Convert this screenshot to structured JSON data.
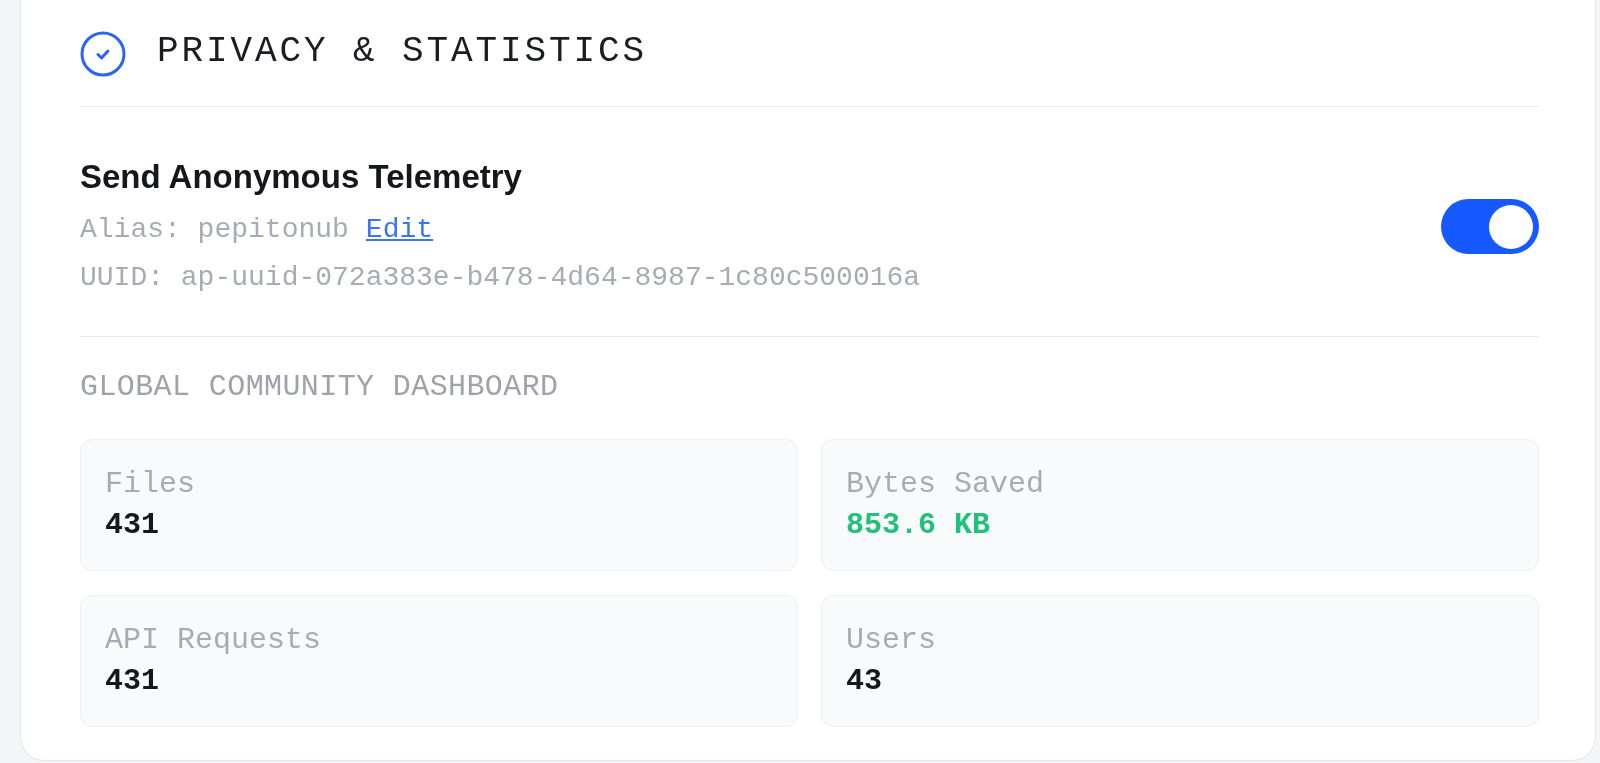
{
  "section": {
    "title": "PRIVACY & STATISTICS"
  },
  "telemetry": {
    "title": "Send Anonymous Telemetry",
    "alias": "Alias: pepitonub",
    "edit_link": "Edit",
    "uuid": "UUID: ap-uuid-072a383e-b478-4d64-8987-1c80c500016a",
    "on": true
  },
  "dashboard": {
    "title": "GLOBAL COMMUNITY DASHBOARD",
    "stats": [
      {
        "label": "Files",
        "value": "431",
        "kind": "count"
      },
      {
        "label": "Bytes Saved",
        "value": "853.6 KB",
        "kind": "savings"
      },
      {
        "label": "API Requests",
        "value": "431",
        "kind": "count"
      },
      {
        "label": "Users",
        "value": "43",
        "kind": "count"
      }
    ]
  }
}
